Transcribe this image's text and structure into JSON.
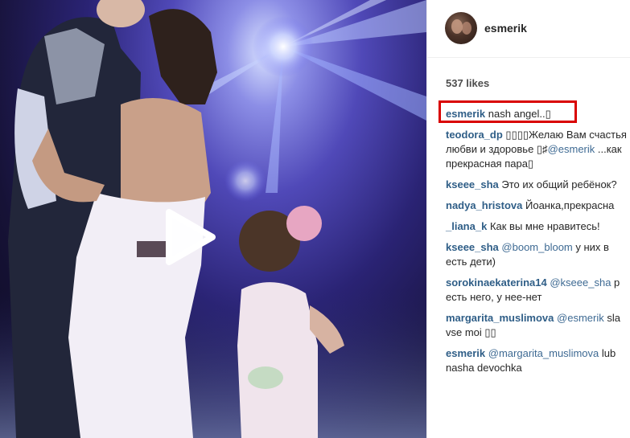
{
  "post": {
    "username": "esmerik",
    "likes_text": "537 likes"
  },
  "icons": {
    "play": "play-icon",
    "avatar": "profile-avatar"
  },
  "colors": {
    "author_link": "#2f5e87",
    "highlight_box": "#d90000",
    "stage_light": "#5049b8"
  },
  "comments": [
    {
      "author": "esmerik",
      "lines": [
        [
          {
            "t": "text",
            "v": "nash angel..▯"
          }
        ]
      ]
    },
    {
      "author": "teodora_dp",
      "lines": [
        [
          {
            "t": "text",
            "v": "▯▯▯▯Желаю Вам счастья"
          }
        ],
        [
          {
            "t": "text",
            "v": "любви и здоровье ▯♯"
          },
          {
            "t": "mention",
            "v": "@esmerik"
          },
          {
            "t": "text",
            "v": " ...как"
          }
        ],
        [
          {
            "t": "text",
            "v": "прекрасная пара▯"
          }
        ]
      ]
    },
    {
      "author": "kseee_sha",
      "lines": [
        [
          {
            "t": "text",
            "v": "Это их общий ребёнок?"
          }
        ]
      ]
    },
    {
      "author": "nadya_hristova",
      "lines": [
        [
          {
            "t": "text",
            "v": "Йоанка,прекрасна"
          }
        ]
      ]
    },
    {
      "author": "_liana_k",
      "lines": [
        [
          {
            "t": "text",
            "v": "Как вы мне нравитесь!"
          }
        ]
      ]
    },
    {
      "author": "kseee_sha",
      "lines": [
        [
          {
            "t": "mention",
            "v": "@boom_bloom"
          },
          {
            "t": "text",
            "v": " у них в"
          }
        ],
        [
          {
            "t": "text",
            "v": "есть дети)"
          }
        ]
      ]
    },
    {
      "author": "sorokinaekaterina14",
      "lines": [
        [
          {
            "t": "mention",
            "v": "@kseee_sha"
          },
          {
            "t": "text",
            "v": " р"
          }
        ],
        [
          {
            "t": "text",
            "v": "есть него, у нее-нет"
          }
        ]
      ]
    },
    {
      "author": "margarita_muslimova",
      "lines": [
        [
          {
            "t": "mention",
            "v": "@esmerik"
          },
          {
            "t": "text",
            "v": " sla"
          }
        ],
        [
          {
            "t": "text",
            "v": "vse moi ▯▯"
          }
        ]
      ]
    },
    {
      "author": "esmerik",
      "lines": [
        [
          {
            "t": "mention",
            "v": "@margarita_muslimova"
          },
          {
            "t": "text",
            "v": " lub"
          }
        ],
        [
          {
            "t": "text",
            "v": "nasha devochka"
          }
        ]
      ]
    }
  ]
}
